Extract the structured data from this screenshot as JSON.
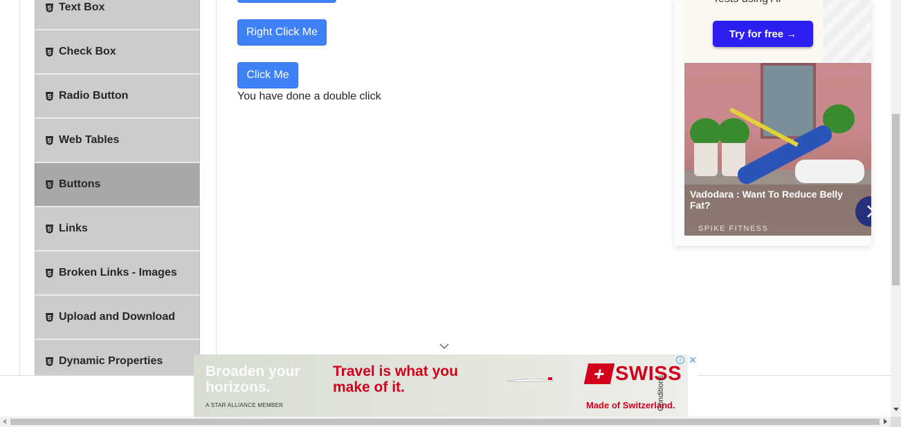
{
  "sidebar": {
    "items": [
      {
        "label": "Text Box",
        "icon": "html5-icon",
        "active": false
      },
      {
        "label": "Check Box",
        "icon": "html5-icon",
        "active": false
      },
      {
        "label": "Radio Button",
        "icon": "html5-icon",
        "active": false
      },
      {
        "label": "Web Tables",
        "icon": "html5-icon",
        "active": false
      },
      {
        "label": "Buttons",
        "icon": "html5-icon",
        "active": true
      },
      {
        "label": "Links",
        "icon": "html5-icon",
        "active": false
      },
      {
        "label": "Broken Links - Images",
        "icon": "html5-icon",
        "active": false
      },
      {
        "label": "Upload and Download",
        "icon": "html5-icon",
        "active": false
      },
      {
        "label": "Dynamic Properties",
        "icon": "html5-icon",
        "active": false
      }
    ]
  },
  "main": {
    "right_click_label": "Right Click Me",
    "click_label": "Click Me",
    "double_click_message": "You have done a double click"
  },
  "ad_right": {
    "top_text": "Tests using AI",
    "cta_label": "Try for free →",
    "headline": "Vadodara : Want To Reduce Belly Fat?",
    "brand": "SPIKE FITNESS",
    "next_icon": "chevron-right-icon"
  },
  "ad_bottom": {
    "headline_1": "Broaden your horizons.",
    "headline_2": "Travel is what you make of it.",
    "star_alliance": "A STAR ALLIANCE MEMBER",
    "logo_text": "SWISS",
    "tagline": "Made of Switzerland.",
    "conditions": "Conditions",
    "info_symbol": "i",
    "close_symbol": "✕"
  },
  "colors": {
    "button_blue": "#3f82f7",
    "sidebar_bg": "#cccccc",
    "sidebar_active": "#a8a8a8",
    "cta_blue": "#2d1ef2",
    "swiss_red": "#d2001c"
  }
}
